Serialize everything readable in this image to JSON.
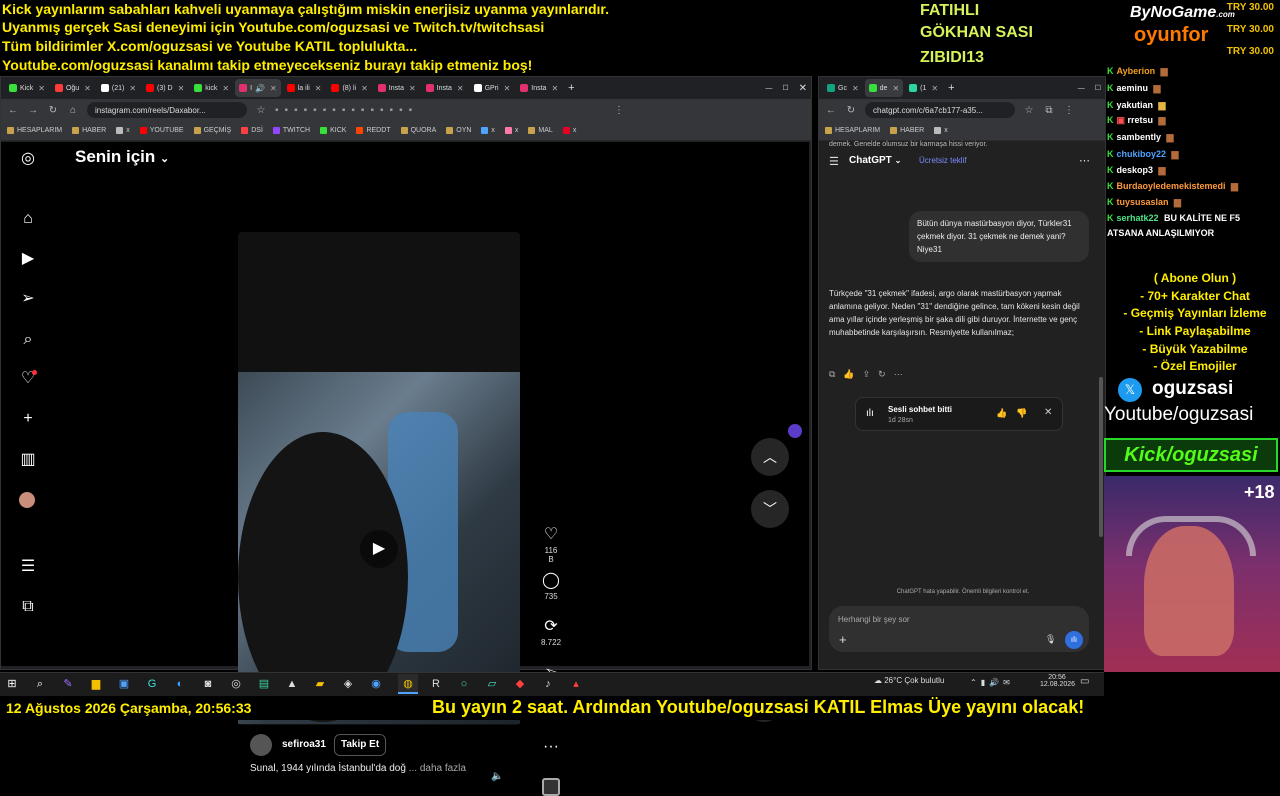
{
  "ticker": {
    "line1": "Kick yayınlarım sabahları kahveli uyanmaya çalıştığım miskin enerjisiz uyanma yayınlarıdır.",
    "line2": "Uyanmış gerçek Sasi deneyimi için Youtube.com/oguzsasi ve Twitch.tv/twitchsasi",
    "line3": "Tüm bildirimler X.com/oguzsasi ve Youtube KATIL topluluktа...",
    "line4": "Youtube.com/oguzsasi kanalımı takip etmeyecekseniz burayı takip etmeniz boş!"
  },
  "gifters": [
    "FATIHLI",
    "GÖKHAN SASI",
    "ZIBIDI13"
  ],
  "sponsor": {
    "brand1": "ByNoGame",
    "brand1_sub": ".com",
    "brand2": "oyunfor",
    "prices": [
      "TRY 30.00",
      "TRY 30.00",
      "TRY 30.00"
    ]
  },
  "left_browser": {
    "tabs": [
      "Kick",
      "Oğu",
      "(21)",
      "(3) D",
      "kick",
      "I",
      "la ili",
      "(8) li",
      "Insta",
      "Insta",
      "GPri",
      "Insta"
    ],
    "url": "instagram.com/reels/Daxabor...",
    "bookmarks": [
      "HESAPLARIM",
      "HABER",
      "x",
      "YOUTUBE",
      "GEÇMİŞ",
      "DSİ",
      "TWITCH",
      "KICK",
      "REDDT",
      "QUORA",
      "OYN",
      "x",
      "x",
      "MAL",
      "x"
    ]
  },
  "instagram": {
    "feed_title": "Senin için",
    "likes": "116 B",
    "comments": "735",
    "reposts": "8.722",
    "username": "sefiroa31",
    "follow_label": "Takip Et",
    "caption": "Sunal, 1944 yılında İstanbul'da doğ",
    "more_label": "... daha fazla"
  },
  "right_browser": {
    "tabs": [
      "Gc",
      "de",
      "(1"
    ],
    "url": "chatgpt.com/c/6a7cb177-a35...",
    "bookmarks": [
      "HESAPLARIM",
      "HABER",
      "x"
    ]
  },
  "chatgpt": {
    "overflow_text": "demek. Genelde olumsuz bir karmaşa hissi veriyor.",
    "app_name": "ChatGPT",
    "offer": "Ücretsiz teklif",
    "user_message": "Bütün dünya mastürbasyon diyor, Türkler31 çekmek diyor. 31 çekmek ne demek yani? Niye31",
    "reply": "Türkçede \"31 çekmek\" ifadesi, argo olarak mastürbasyon yapmak anlamına geliyor. Neden \"31\" dendiğine gelince, tam kökeni kesin değil ama yıllar içinde yerleşmiş bir şaka dili gibi duruyor. İnternette ve genç muhabbetinde karşılaşırsın. Resmiyette kullanılmaz;",
    "voice_title": "Sesli sohbet bitti",
    "voice_time": "1d 28sn",
    "disclaimer": "ChatGPT hata yapabilir. Önemli bilgileri kontrol et.",
    "input_placeholder": "Herhangi bir şey sor"
  },
  "chat": [
    {
      "user": "Ayberion",
      "color": "#f0a020",
      "msg": ""
    },
    {
      "user": "aeminu",
      "color": "#ffffff",
      "msg": ""
    },
    {
      "user": "yakutian",
      "color": "#ffffff",
      "msg": ""
    },
    {
      "user": "rretsu",
      "color": "#ffffff",
      "msg": ""
    },
    {
      "user": "sambently",
      "color": "#ffffff",
      "msg": ""
    },
    {
      "user": "chukiboy22",
      "color": "#4fa3ff",
      "msg": ""
    },
    {
      "user": "deskop3",
      "color": "#ffffff",
      "msg": ""
    },
    {
      "user": "Burdaoyledemekistemedi",
      "color": "#ff9a3c",
      "msg": ""
    },
    {
      "user": "tuysusaslan",
      "color": "#ff9a3c",
      "msg": ""
    },
    {
      "user": "serhatk22",
      "color": "#4fe38a",
      "msg": "BU KALİTE NE F5"
    }
  ],
  "chat_cont": "ATSANA ANLAŞILMIYOR",
  "features": [
    "( Abone Olun )",
    "- 70+ Karakter Chat",
    "- Geçmiş Yayınları İzleme",
    "- Link Paylaşabilme",
    "- Büyük Yazabilme",
    "- Özel Emojiler"
  ],
  "socials": {
    "x_handle": "oguzsasi",
    "youtube": "Youtube/oguzsasi",
    "kick": "Kick/oguzsasi",
    "viewer_plus": "+18"
  },
  "taskbar": {
    "weather": "26°C  Çok bulutlu",
    "time": "20:56",
    "date": "12.08.2026"
  },
  "bottom": {
    "datetime": "12 Ağustos 2026 Çarşamba, 20:56:33",
    "scroll": "Bu yayın 2 saat. Ardından Youtube/oguzsasi KATIL Elmas Üye yayını olacak!"
  }
}
